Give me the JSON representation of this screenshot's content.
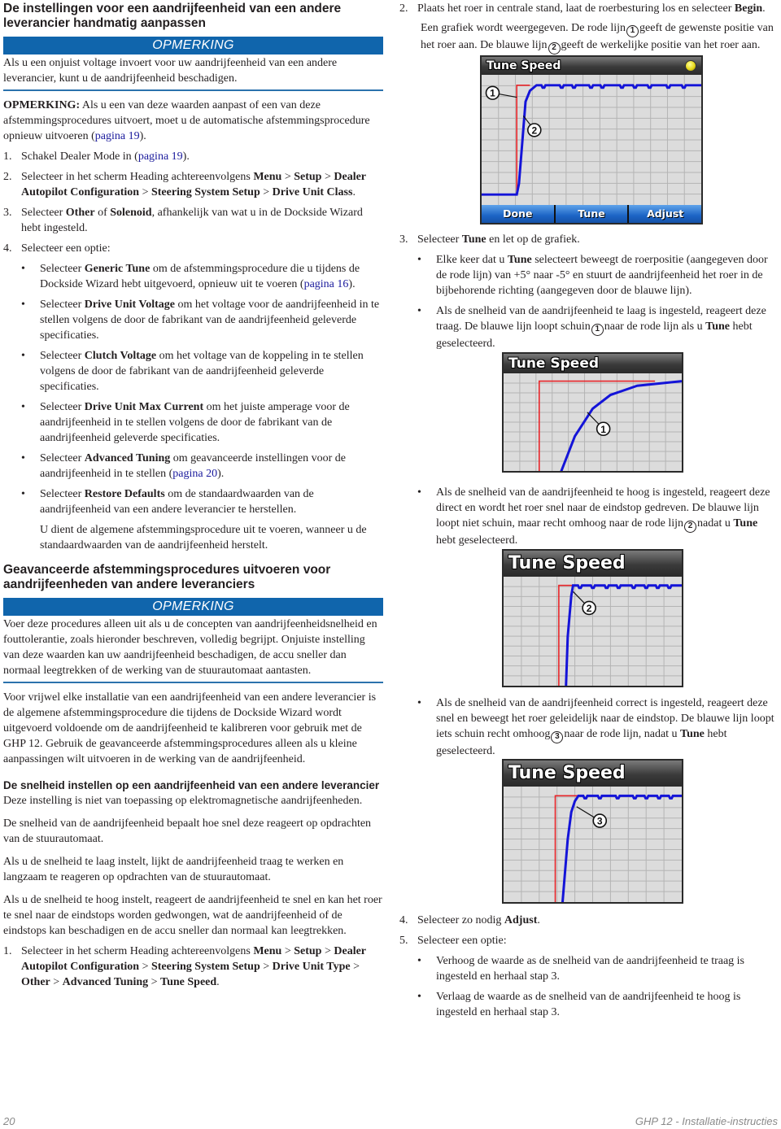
{
  "left": {
    "section1": {
      "title": "De instellingen voor een aandrijfeenheid van een andere leverancier handmatig aanpassen",
      "notice": {
        "label": "OPMERKING",
        "text": "Als u een onjuist voltage invoert voor uw aandrijfeenheid van een andere leverancier, kunt u de aandrijfeenheid beschadigen."
      },
      "note": {
        "prefix": "OPMERKING:",
        "text": " Als u een van deze waarden aanpast of een van deze afstemmingsprocedures uitvoert, moet u de automatische afstemmingsprocedure opnieuw uitvoeren (",
        "link": "pagina 19",
        "suffix": ")."
      },
      "steps": [
        {
          "num": "1.",
          "pre": "Schakel Dealer Mode in (",
          "link": "pagina 19",
          "post": ")."
        },
        {
          "num": "2.",
          "pre": "Selecteer in het scherm Heading achtereenvolgens ",
          "path": [
            {
              "t": "Menu",
              "b": true
            },
            {
              "t": " > ",
              "b": false
            },
            {
              "t": "Setup",
              "b": true
            },
            {
              "t": " > ",
              "b": false
            },
            {
              "t": "Dealer Autopilot Configuration",
              "b": true
            },
            {
              "t": " > ",
              "b": false
            },
            {
              "t": "Steering System Setup",
              "b": true
            },
            {
              "t": " > ",
              "b": false
            },
            {
              "t": "Drive Unit Class",
              "b": true
            },
            {
              "t": ".",
              "b": false
            }
          ]
        },
        {
          "num": "3.",
          "pre": "Selecteer ",
          "bold1": "Other",
          "mid": " of ",
          "bold2": "Solenoid",
          "post": ", afhankelijk van wat u in de Dockside Wizard hebt ingesteld."
        },
        {
          "num": "4.",
          "text": "Selecteer een optie:"
        }
      ],
      "options": [
        {
          "pre": "Selecteer ",
          "bold": "Generic Tune",
          "post": " om de afstemmingsprocedure die u tijdens de Dockside Wizard hebt uitgevoerd, opnieuw uit te voeren (",
          "link": "pagina 16",
          "end": ")."
        },
        {
          "pre": "Selecteer ",
          "bold": "Drive Unit Voltage",
          "post": " om het voltage voor de aandrijfeenheid in te stellen volgens de door de fabrikant van de aandrijfeenheid geleverde specificaties."
        },
        {
          "pre": "Selecteer ",
          "bold": "Clutch Voltage",
          "post": " om het voltage van de koppeling in te stellen volgens de door de fabrikant van de aandrijfeenheid geleverde specificaties."
        },
        {
          "pre": "Selecteer ",
          "bold": "Drive Unit Max Current",
          "post": " om het juiste amperage voor de aandrijfeenheid in te stellen volgens de door de fabrikant van de aandrijfeenheid geleverde specificaties."
        },
        {
          "pre": "Selecteer ",
          "bold": "Advanced Tuning",
          "post": " om geavanceerde instellingen voor de aandrijfeenheid in te stellen (",
          "link": "pagina 20",
          "end": ")."
        },
        {
          "pre": "Selecteer ",
          "bold": "Restore Defaults",
          "post": " om de standaardwaarden van de aandrijfeenheid van een andere leverancier te herstellen."
        }
      ],
      "restore_note": "U dient de algemene afstemmingsprocedure uit te voeren, wanneer u de standaardwaarden van de aandrijfeenheid herstelt."
    },
    "section2": {
      "title": "Geavanceerde afstemmingsprocedures uitvoeren voor aandrijfeenheden van andere leveranciers",
      "notice": {
        "label": "OPMERKING",
        "text": "Voer deze procedures alleen uit als u de concepten van aandrijfeenheidsnelheid en fouttolerantie, zoals hieronder beschreven, volledig begrijpt. Onjuiste instelling van deze waarden kan uw aandrijfeenheid beschadigen, de accu sneller dan normaal leegtrekken of de werking van de stuurautomaat aantasten."
      },
      "intro": "Voor vrijwel elke installatie van een aandrijfeenheid van een andere leverancier is de algemene afstemmingsprocedure die tijdens de Dockside Wizard wordt uitgevoerd voldoende om de aandrijfeenheid te kalibreren voor gebruik met de GHP 12. Gebruik de geavanceerde afstemmingsprocedures alleen als u kleine aanpassingen wilt uitvoeren in de werking van de aandrijfeenheid."
    },
    "section3": {
      "title": "De snelheid instellen op een aandrijfeenheid van een andere leverancier",
      "p1": "Deze instelling is niet van toepassing op elektromagnetische aandrijfeenheden.",
      "p2": "De snelheid van de aandrijfeenheid bepaalt hoe snel deze reageert op opdrachten van de stuurautomaat.",
      "p3": "Als u de snelheid te laag instelt, lijkt de aandrijfeenheid traag te werken en langzaam te reageren op opdrachten van de stuurautomaat.",
      "p4": "Als u de snelheid te hoog instelt, reageert de aandrijfeenheid te snel en kan het roer te snel naar de eindstops worden gedwongen, wat de aandrijfeenheid of de eindstops kan beschadigen en de accu sneller dan normaal kan leegtrekken.",
      "step1": {
        "num": "1.",
        "pre": "Selecteer in het scherm Heading achtereenvolgens ",
        "path": [
          {
            "t": "Menu",
            "b": true
          },
          {
            "t": " > ",
            "b": false
          },
          {
            "t": "Setup",
            "b": true
          },
          {
            "t": " > ",
            "b": false
          },
          {
            "t": "Dealer Autopilot Configuration",
            "b": true
          },
          {
            "t": " > ",
            "b": false
          },
          {
            "t": "Steering System Setup",
            "b": true
          },
          {
            "t": " > ",
            "b": false
          },
          {
            "t": "Drive Unit Type",
            "b": true
          },
          {
            "t": " > ",
            "b": false
          },
          {
            "t": "Other",
            "b": true
          },
          {
            "t": " > ",
            "b": false
          },
          {
            "t": "Advanced Tuning",
            "b": true
          },
          {
            "t": " > ",
            "b": false
          },
          {
            "t": "Tune Speed",
            "b": true
          },
          {
            "t": ".",
            "b": false
          }
        ]
      }
    }
  },
  "right": {
    "step2": {
      "num": "2.",
      "pre": "Plaats het roer in centrale stand, laat de roerbesturing los en selecteer ",
      "bold": "Begin",
      "post": ".",
      "desc_a": "Een grafiek wordt weergegeven. De rode lijn",
      "callout1": "1",
      "desc_b": "geeft de gewenste positie van het roer aan. De blauwe lijn",
      "callout2": "2",
      "desc_c": "geeft de werkelijke positie van het roer aan."
    },
    "step3": {
      "num": "3.",
      "pre": "Selecteer ",
      "bold": "Tune",
      "post": " en let op de grafiek.",
      "bullets": [
        {
          "pre": "Elke keer dat u ",
          "bold": "Tune",
          "post": " selecteert beweegt de roerpositie (aangegeven door de rode lijn) van +5° naar -5° en stuurt de aandrijfeenheid het roer in de bijbehorende richting (aangegeven door de blauwe lijn)."
        },
        {
          "pre": "Als de snelheid van de aandrijfeenheid te laag is ingesteld, reageert deze traag. De blauwe lijn loopt schuin",
          "callout": "1",
          "mid": "naar de rode lijn als u ",
          "bold": "Tune",
          "post": " hebt geselecteerd."
        },
        {
          "pre": "Als de snelheid van de aandrijfeenheid te hoog is ingesteld, reageert deze direct en wordt het roer snel naar de eindstop gedreven. De blauwe lijn loopt niet schuin, maar recht omhoog naar de rode lijn",
          "callout": "2",
          "mid": "nadat u ",
          "bold": "Tune",
          "post": " hebt geselecteerd."
        },
        {
          "pre": "Als de snelheid van de aandrijfeenheid correct is ingesteld, reageert deze snel en beweegt het roer geleidelijk naar de eindstop. De blauwe lijn loopt iets schuin recht omhoog",
          "callout": "3",
          "mid": "naar de rode lijn, nadat u ",
          "bold": "Tune",
          "post": " hebt geselecteerd."
        }
      ]
    },
    "step4": {
      "num": "4.",
      "pre": "Selecteer zo nodig ",
      "bold": "Adjust",
      "post": "."
    },
    "step5": {
      "num": "5.",
      "text": "Selecteer een optie:",
      "bullets": [
        "Verhoog de waarde as de snelheid van de aandrijfeenheid te traag is ingesteld en herhaal stap 3.",
        "Verlaag de waarde as de snelheid van de aandrijfeenheid te hoog is ingesteld en herhaal stap 3."
      ]
    }
  },
  "screens": {
    "title": "Tune Speed",
    "softkeys": [
      "Done",
      "Tune",
      "Adjust"
    ],
    "colors": {
      "desired": "#e8262a",
      "actual": "#1414d8",
      "plot_bg": "#dcdcdc",
      "grid": "#b4b4b4"
    },
    "callouts": [
      "1",
      "2",
      "3"
    ]
  },
  "chart_data": [
    {
      "type": "line",
      "title": "Tune Speed",
      "xlabel": "",
      "ylabel": "",
      "ylim": [
        -5,
        5
      ],
      "grid": true,
      "series": [
        {
          "name": "Gewenste roerpositie (rode lijn)",
          "callout": "1",
          "x": [
            0,
            0.16,
            0.16,
            0.22
          ],
          "values": [
            -5,
            -5,
            5,
            5
          ]
        },
        {
          "name": "Werkelijke roerpositie (blauwe lijn)",
          "callout": "2",
          "x": [
            0,
            0.16,
            0.17,
            0.19,
            0.2,
            0.22,
            0.25,
            1.0
          ],
          "values": [
            -5,
            -5,
            -4,
            1,
            3.5,
            4.5,
            5,
            5
          ]
        }
      ],
      "softkeys": [
        "Done",
        "Tune",
        "Adjust"
      ]
    },
    {
      "type": "line",
      "title": "Tune Speed",
      "ylim": [
        -5,
        5
      ],
      "grid": true,
      "series": [
        {
          "name": "Gewenste roerpositie (rode lijn)",
          "x": [
            0.2,
            0.2,
            0.85
          ],
          "values": [
            -5,
            5,
            5
          ]
        },
        {
          "name": "Werkelijke roerpositie (blauwe lijn) - te traag",
          "callout": "1",
          "x": [
            0.32,
            0.4,
            0.5,
            0.6,
            0.75,
            1.0
          ],
          "values": [
            -5,
            -1,
            2,
            3.5,
            4.5,
            5
          ]
        }
      ]
    },
    {
      "type": "line",
      "title": "Tune Speed",
      "ylim": [
        -5,
        5
      ],
      "grid": true,
      "series": [
        {
          "name": "Gewenste roerpositie (rode lijn)",
          "x": [
            0.31,
            0.31,
            0.39
          ],
          "values": [
            -5,
            5,
            5
          ]
        },
        {
          "name": "Werkelijke roerpositie (blauwe lijn) - te snel",
          "callout": "2",
          "x": [
            0.35,
            0.36,
            0.38,
            0.39,
            1.0
          ],
          "values": [
            -5,
            0,
            4,
            5,
            5
          ]
        }
      ]
    },
    {
      "type": "line",
      "title": "Tune Speed",
      "ylim": [
        -5,
        5
      ],
      "grid": true,
      "series": [
        {
          "name": "Gewenste roerpositie (rode lijn)",
          "x": [
            0.29,
            0.29,
            0.43
          ],
          "values": [
            -5,
            5,
            5
          ]
        },
        {
          "name": "Werkelijke roerpositie (blauwe lijn) - correct",
          "callout": "3",
          "x": [
            0.33,
            0.36,
            0.38,
            0.4,
            0.42,
            1.0
          ],
          "values": [
            -5,
            1,
            3.5,
            4.5,
            5,
            5
          ]
        }
      ]
    }
  ],
  "footer": {
    "page_number": "20",
    "doc_title": "GHP 12 - Installatie-instructies"
  }
}
